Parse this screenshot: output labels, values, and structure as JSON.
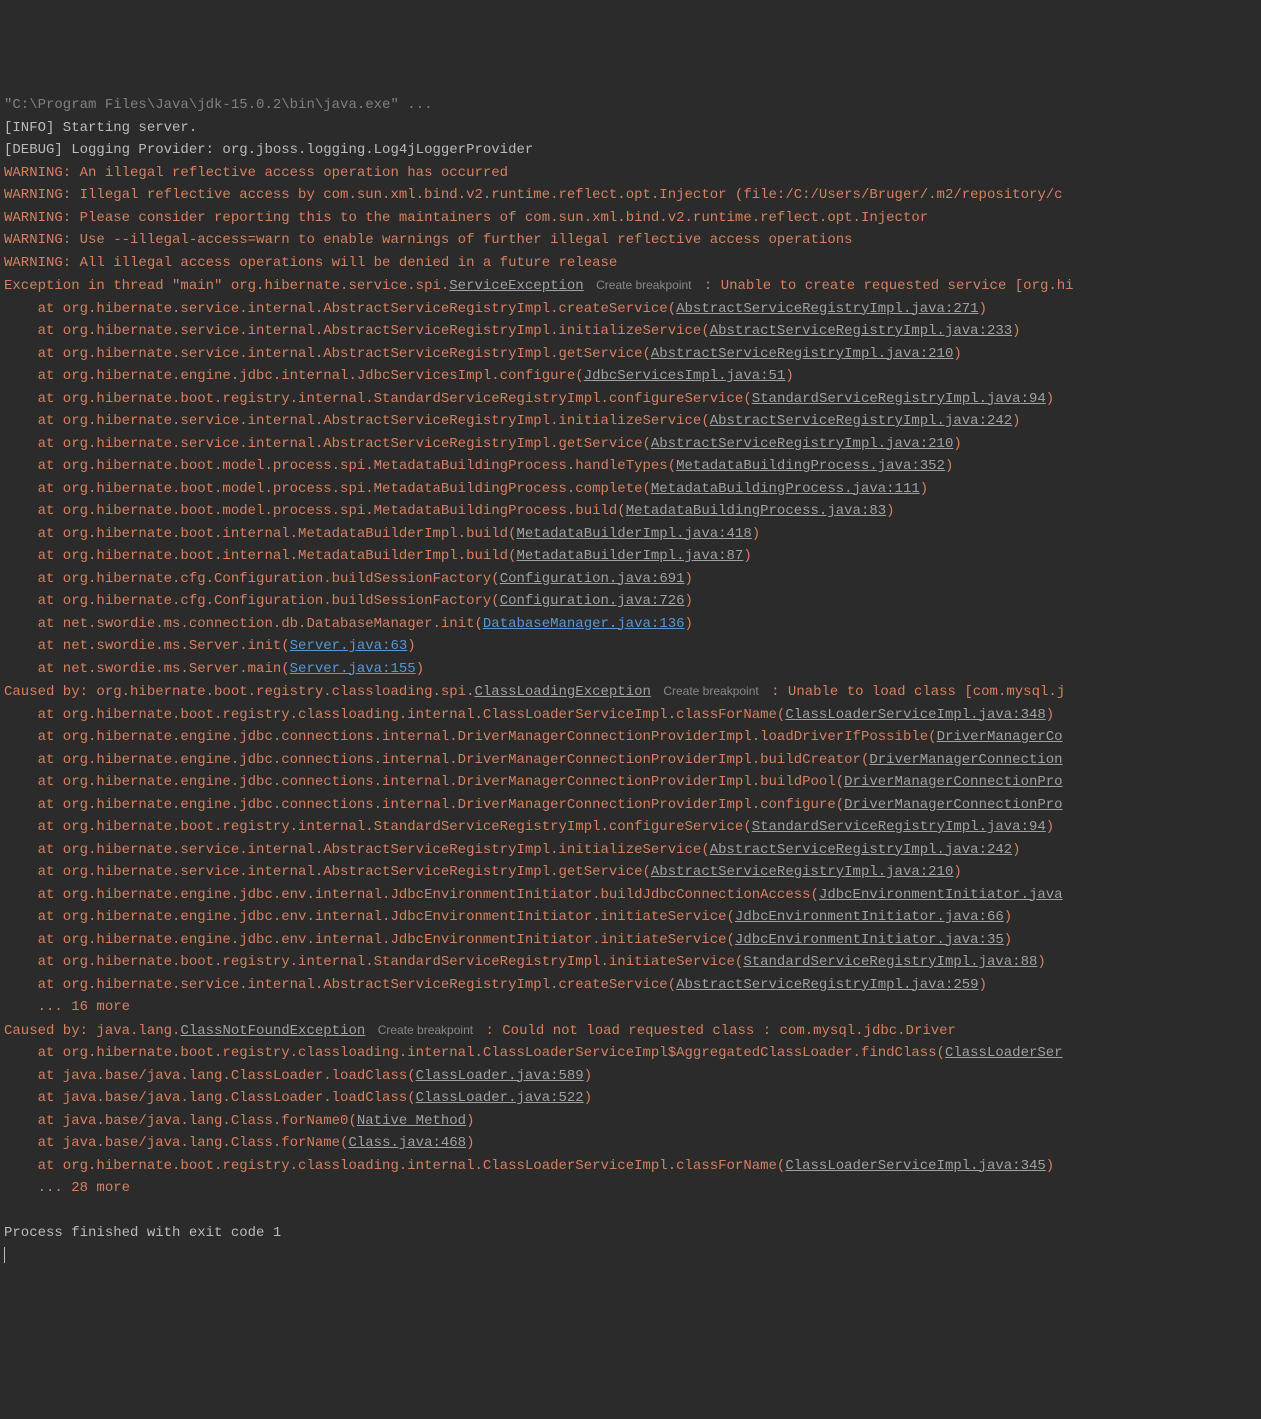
{
  "lines": [
    {
      "segs": [
        {
          "t": "\"C:\\Program Files\\Java\\jdk-15.0.2\\bin\\java.exe\" ...",
          "c": "gray"
        }
      ]
    },
    {
      "segs": [
        {
          "t": "[INFO] Starting server.",
          "c": "default"
        }
      ]
    },
    {
      "segs": [
        {
          "t": "[DEBUG] Logging Provider: org.jboss.logging.Log4jLoggerProvider",
          "c": "default"
        }
      ]
    },
    {
      "segs": [
        {
          "t": "WARNING: An illegal reflective access operation has occurred",
          "c": "orange"
        }
      ]
    },
    {
      "segs": [
        {
          "t": "WARNING: Illegal reflective access by com.sun.xml.bind.v2.runtime.reflect.opt.Injector (file:/C:/Users/Bruger/.m2/repository/c",
          "c": "orange"
        }
      ]
    },
    {
      "segs": [
        {
          "t": "WARNING: Please consider reporting this to the maintainers of com.sun.xml.bind.v2.runtime.reflect.opt.Injector",
          "c": "orange"
        }
      ]
    },
    {
      "segs": [
        {
          "t": "WARNING: Use --illegal-access=warn to enable warnings of further illegal reflective access operations",
          "c": "orange"
        }
      ]
    },
    {
      "segs": [
        {
          "t": "WARNING: All illegal access operations will be denied in a future release",
          "c": "orange"
        }
      ]
    },
    {
      "segs": [
        {
          "t": "Exception in thread \"main\" org.hibernate.service.spi.",
          "c": "orange"
        },
        {
          "t": "ServiceException",
          "c": "link-gray"
        },
        {
          "t": " ",
          "c": "orange"
        },
        {
          "t": "Create breakpoint",
          "c": "breakpoint"
        },
        {
          "t": " : Unable to create requested service [org.hi",
          "c": "orange"
        }
      ]
    },
    {
      "segs": [
        {
          "t": "    at org.hibernate.service.internal.AbstractServiceRegistryImpl.createService(",
          "c": "orange"
        },
        {
          "t": "AbstractServiceRegistryImpl.java:271",
          "c": "link-gray"
        },
        {
          "t": ")",
          "c": "orange"
        }
      ]
    },
    {
      "segs": [
        {
          "t": "    at org.hibernate.service.internal.AbstractServiceRegistryImpl.initializeService(",
          "c": "orange"
        },
        {
          "t": "AbstractServiceRegistryImpl.java:233",
          "c": "link-gray"
        },
        {
          "t": ")",
          "c": "orange"
        }
      ]
    },
    {
      "segs": [
        {
          "t": "    at org.hibernate.service.internal.AbstractServiceRegistryImpl.getService(",
          "c": "orange"
        },
        {
          "t": "AbstractServiceRegistryImpl.java:210",
          "c": "link-gray"
        },
        {
          "t": ")",
          "c": "orange"
        }
      ]
    },
    {
      "segs": [
        {
          "t": "    at org.hibernate.engine.jdbc.internal.JdbcServicesImpl.configure(",
          "c": "orange"
        },
        {
          "t": "JdbcServicesImpl.java:51",
          "c": "link-gray"
        },
        {
          "t": ")",
          "c": "orange"
        }
      ]
    },
    {
      "segs": [
        {
          "t": "    at org.hibernate.boot.registry.internal.StandardServiceRegistryImpl.configureService(",
          "c": "orange"
        },
        {
          "t": "StandardServiceRegistryImpl.java:94",
          "c": "link-gray"
        },
        {
          "t": ")",
          "c": "orange"
        }
      ]
    },
    {
      "segs": [
        {
          "t": "    at org.hibernate.service.internal.AbstractServiceRegistryImpl.initializeService(",
          "c": "orange"
        },
        {
          "t": "AbstractServiceRegistryImpl.java:242",
          "c": "link-gray"
        },
        {
          "t": ")",
          "c": "orange"
        }
      ]
    },
    {
      "segs": [
        {
          "t": "    at org.hibernate.service.internal.AbstractServiceRegistryImpl.getService(",
          "c": "orange"
        },
        {
          "t": "AbstractServiceRegistryImpl.java:210",
          "c": "link-gray"
        },
        {
          "t": ")",
          "c": "orange"
        }
      ]
    },
    {
      "segs": [
        {
          "t": "    at org.hibernate.boot.model.process.spi.MetadataBuildingProcess.handleTypes(",
          "c": "orange"
        },
        {
          "t": "MetadataBuildingProcess.java:352",
          "c": "link-gray"
        },
        {
          "t": ")",
          "c": "orange"
        }
      ]
    },
    {
      "segs": [
        {
          "t": "    at org.hibernate.boot.model.process.spi.MetadataBuildingProcess.complete(",
          "c": "orange"
        },
        {
          "t": "MetadataBuildingProcess.java:111",
          "c": "link-gray"
        },
        {
          "t": ")",
          "c": "orange"
        }
      ]
    },
    {
      "segs": [
        {
          "t": "    at org.hibernate.boot.model.process.spi.MetadataBuildingProcess.build(",
          "c": "orange"
        },
        {
          "t": "MetadataBuildingProcess.java:83",
          "c": "link-gray"
        },
        {
          "t": ")",
          "c": "orange"
        }
      ]
    },
    {
      "segs": [
        {
          "t": "    at org.hibernate.boot.internal.MetadataBuilderImpl.build(",
          "c": "orange"
        },
        {
          "t": "MetadataBuilderImpl.java:418",
          "c": "link-gray"
        },
        {
          "t": ")",
          "c": "orange"
        }
      ]
    },
    {
      "segs": [
        {
          "t": "    at org.hibernate.boot.internal.MetadataBuilderImpl.build(",
          "c": "orange"
        },
        {
          "t": "MetadataBuilderImpl.java:87",
          "c": "link-gray"
        },
        {
          "t": ")",
          "c": "orange"
        }
      ]
    },
    {
      "segs": [
        {
          "t": "    at org.hibernate.cfg.Configuration.buildSessionFactory(",
          "c": "orange"
        },
        {
          "t": "Configuration.java:691",
          "c": "link-gray"
        },
        {
          "t": ")",
          "c": "orange"
        }
      ]
    },
    {
      "segs": [
        {
          "t": "    at org.hibernate.cfg.Configuration.buildSessionFactory(",
          "c": "orange"
        },
        {
          "t": "Configuration.java:726",
          "c": "link-gray"
        },
        {
          "t": ")",
          "c": "orange"
        }
      ]
    },
    {
      "segs": [
        {
          "t": "    at net.swordie.ms.connection.db.DatabaseManager.init(",
          "c": "orange"
        },
        {
          "t": "DatabaseManager.java:136",
          "c": "link-blue"
        },
        {
          "t": ")",
          "c": "orange"
        }
      ]
    },
    {
      "segs": [
        {
          "t": "    at net.swordie.ms.Server.init(",
          "c": "orange"
        },
        {
          "t": "Server.java:63",
          "c": "link-blue"
        },
        {
          "t": ")",
          "c": "orange"
        }
      ]
    },
    {
      "segs": [
        {
          "t": "    at net.swordie.ms.Server.main(",
          "c": "orange"
        },
        {
          "t": "Server.java:155",
          "c": "link-blue"
        },
        {
          "t": ")",
          "c": "orange"
        }
      ]
    },
    {
      "segs": [
        {
          "t": "Caused by: org.hibernate.boot.registry.classloading.spi.",
          "c": "orange"
        },
        {
          "t": "ClassLoadingException",
          "c": "link-gray"
        },
        {
          "t": " ",
          "c": "orange"
        },
        {
          "t": "Create breakpoint",
          "c": "breakpoint"
        },
        {
          "t": " : Unable to load class [com.mysql.j",
          "c": "orange"
        }
      ]
    },
    {
      "segs": [
        {
          "t": "    at org.hibernate.boot.registry.classloading.internal.ClassLoaderServiceImpl.classForName(",
          "c": "orange"
        },
        {
          "t": "ClassLoaderServiceImpl.java:348",
          "c": "link-gray"
        },
        {
          "t": ")",
          "c": "orange"
        }
      ]
    },
    {
      "segs": [
        {
          "t": "    at org.hibernate.engine.jdbc.connections.internal.DriverManagerConnectionProviderImpl.loadDriverIfPossible(",
          "c": "orange"
        },
        {
          "t": "DriverManagerCo",
          "c": "link-gray"
        }
      ]
    },
    {
      "segs": [
        {
          "t": "    at org.hibernate.engine.jdbc.connections.internal.DriverManagerConnectionProviderImpl.buildCreator(",
          "c": "orange"
        },
        {
          "t": "DriverManagerConnection",
          "c": "link-gray"
        }
      ]
    },
    {
      "segs": [
        {
          "t": "    at org.hibernate.engine.jdbc.connections.internal.DriverManagerConnectionProviderImpl.buildPool(",
          "c": "orange"
        },
        {
          "t": "DriverManagerConnectionPro",
          "c": "link-gray"
        }
      ]
    },
    {
      "segs": [
        {
          "t": "    at org.hibernate.engine.jdbc.connections.internal.DriverManagerConnectionProviderImpl.configure(",
          "c": "orange"
        },
        {
          "t": "DriverManagerConnectionPro",
          "c": "link-gray"
        }
      ]
    },
    {
      "segs": [
        {
          "t": "    at org.hibernate.boot.registry.internal.StandardServiceRegistryImpl.configureService(",
          "c": "orange"
        },
        {
          "t": "StandardServiceRegistryImpl.java:94",
          "c": "link-gray"
        },
        {
          "t": ")",
          "c": "orange"
        }
      ]
    },
    {
      "segs": [
        {
          "t": "    at org.hibernate.service.internal.AbstractServiceRegistryImpl.initializeService(",
          "c": "orange"
        },
        {
          "t": "AbstractServiceRegistryImpl.java:242",
          "c": "link-gray"
        },
        {
          "t": ")",
          "c": "orange"
        }
      ]
    },
    {
      "segs": [
        {
          "t": "    at org.hibernate.service.internal.AbstractServiceRegistryImpl.getService(",
          "c": "orange"
        },
        {
          "t": "AbstractServiceRegistryImpl.java:210",
          "c": "link-gray"
        },
        {
          "t": ")",
          "c": "orange"
        }
      ]
    },
    {
      "segs": [
        {
          "t": "    at org.hibernate.engine.jdbc.env.internal.JdbcEnvironmentInitiator.buildJdbcConnectionAccess(",
          "c": "orange"
        },
        {
          "t": "JdbcEnvironmentInitiator.java",
          "c": "link-gray"
        }
      ]
    },
    {
      "segs": [
        {
          "t": "    at org.hibernate.engine.jdbc.env.internal.JdbcEnvironmentInitiator.initiateService(",
          "c": "orange"
        },
        {
          "t": "JdbcEnvironmentInitiator.java:66",
          "c": "link-gray"
        },
        {
          "t": ")",
          "c": "orange"
        }
      ]
    },
    {
      "segs": [
        {
          "t": "    at org.hibernate.engine.jdbc.env.internal.JdbcEnvironmentInitiator.initiateService(",
          "c": "orange"
        },
        {
          "t": "JdbcEnvironmentInitiator.java:35",
          "c": "link-gray"
        },
        {
          "t": ")",
          "c": "orange"
        }
      ]
    },
    {
      "segs": [
        {
          "t": "    at org.hibernate.boot.registry.internal.StandardServiceRegistryImpl.initiateService(",
          "c": "orange"
        },
        {
          "t": "StandardServiceRegistryImpl.java:88",
          "c": "link-gray"
        },
        {
          "t": ")",
          "c": "orange"
        }
      ]
    },
    {
      "segs": [
        {
          "t": "    at org.hibernate.service.internal.AbstractServiceRegistryImpl.createService(",
          "c": "orange"
        },
        {
          "t": "AbstractServiceRegistryImpl.java:259",
          "c": "link-gray"
        },
        {
          "t": ")",
          "c": "orange"
        }
      ]
    },
    {
      "segs": [
        {
          "t": "    ... 16 more",
          "c": "orange"
        }
      ]
    },
    {
      "segs": [
        {
          "t": "Caused by: java.lang.",
          "c": "orange"
        },
        {
          "t": "ClassNotFoundException",
          "c": "link-gray"
        },
        {
          "t": " ",
          "c": "orange"
        },
        {
          "t": "Create breakpoint",
          "c": "breakpoint"
        },
        {
          "t": " : Could not load requested class : com.mysql.jdbc.Driver",
          "c": "orange"
        }
      ]
    },
    {
      "segs": [
        {
          "t": "    at org.hibernate.boot.registry.classloading.internal.ClassLoaderServiceImpl$AggregatedClassLoader.findClass(",
          "c": "orange"
        },
        {
          "t": "ClassLoaderSer",
          "c": "link-gray"
        }
      ]
    },
    {
      "segs": [
        {
          "t": "    at java.base/java.lang.ClassLoader.loadClass(",
          "c": "orange"
        },
        {
          "t": "ClassLoader.java:589",
          "c": "link-gray"
        },
        {
          "t": ")",
          "c": "orange"
        }
      ]
    },
    {
      "segs": [
        {
          "t": "    at java.base/java.lang.ClassLoader.loadClass(",
          "c": "orange"
        },
        {
          "t": "ClassLoader.java:522",
          "c": "link-gray"
        },
        {
          "t": ")",
          "c": "orange"
        }
      ]
    },
    {
      "segs": [
        {
          "t": "    at java.base/java.lang.Class.forName0(",
          "c": "orange"
        },
        {
          "t": "Native Method",
          "c": "link-gray"
        },
        {
          "t": ")",
          "c": "orange"
        }
      ]
    },
    {
      "segs": [
        {
          "t": "    at java.base/java.lang.Class.forName(",
          "c": "orange"
        },
        {
          "t": "Class.java:468",
          "c": "link-gray"
        },
        {
          "t": ")",
          "c": "orange"
        }
      ]
    },
    {
      "segs": [
        {
          "t": "    at org.hibernate.boot.registry.classloading.internal.ClassLoaderServiceImpl.classForName(",
          "c": "orange"
        },
        {
          "t": "ClassLoaderServiceImpl.java:345",
          "c": "link-gray"
        },
        {
          "t": ")",
          "c": "orange"
        }
      ]
    },
    {
      "segs": [
        {
          "t": "    ... 28 more",
          "c": "orange"
        }
      ]
    },
    {
      "segs": [
        {
          "t": " ",
          "c": "default"
        }
      ]
    },
    {
      "segs": [
        {
          "t": "Process finished with exit code 1",
          "c": "default"
        }
      ]
    }
  ]
}
